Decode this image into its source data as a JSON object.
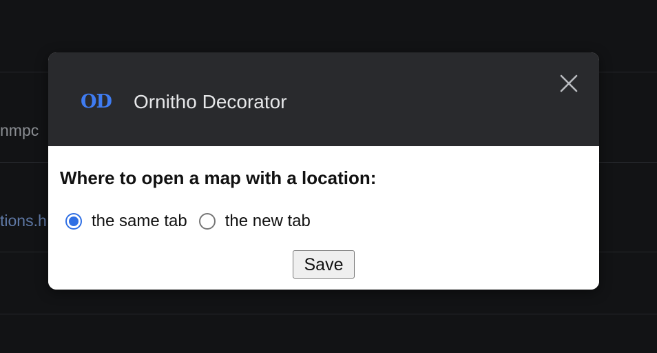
{
  "background": {
    "partial_text_1": "nmpc",
    "partial_text_2": "tions.h"
  },
  "dialog": {
    "logo_text": "OD",
    "title": "Ornitho Decorator",
    "close_icon": "close-icon",
    "question": "Where to open a map with a location:",
    "options": [
      {
        "label": "the same tab",
        "checked": true
      },
      {
        "label": "the new tab",
        "checked": false
      }
    ],
    "save_label": "Save"
  },
  "colors": {
    "page_bg": "#121315",
    "header_bg": "#292a2d",
    "logo": "#3f7cf2",
    "radio_accent": "#2f6fe4"
  }
}
